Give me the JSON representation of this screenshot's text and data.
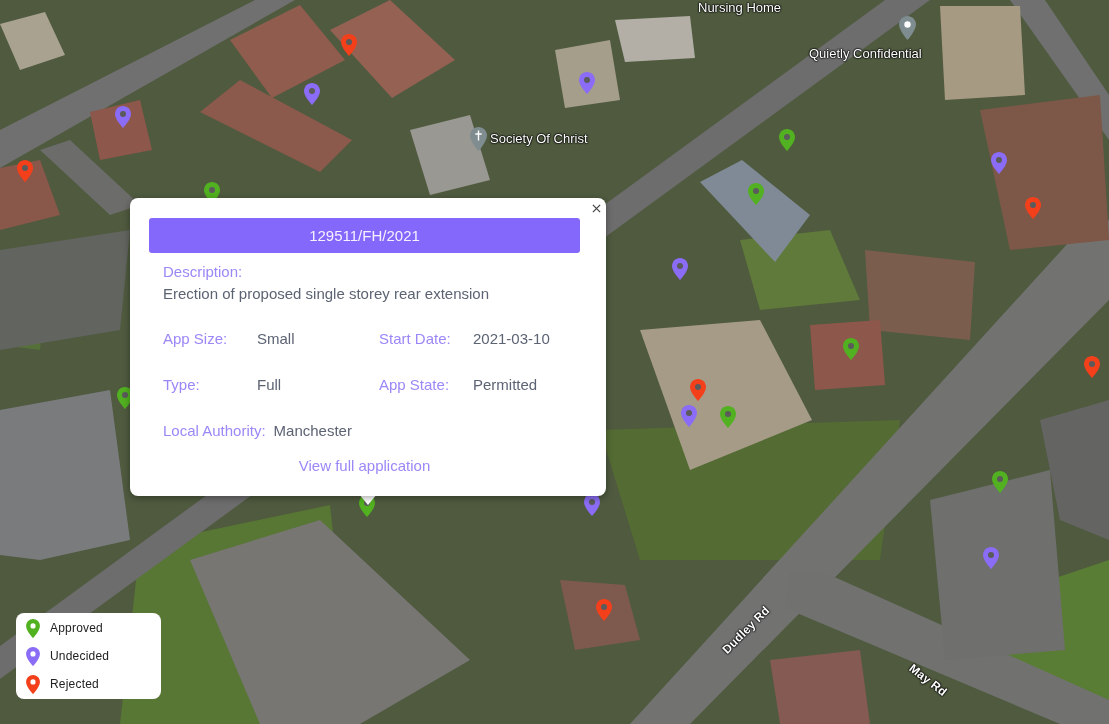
{
  "map_labels": [
    {
      "kind": "text",
      "text": "Nursing Home"
    },
    {
      "kind": "church",
      "text": "Society Of Christ"
    },
    {
      "kind": "place",
      "text": "Quietly Confidential"
    },
    {
      "kind": "road",
      "text": "Dudley Rd"
    },
    {
      "kind": "road",
      "text": "May Rd"
    }
  ],
  "pins": [
    {
      "color": "#f3401b"
    },
    {
      "color": "#8b6cf6"
    },
    {
      "color": "#8b6cf6"
    },
    {
      "color": "#f3401b"
    },
    {
      "color": "#52b120"
    },
    {
      "color": "#8b6cf6"
    },
    {
      "color": "#52b120"
    },
    {
      "color": "#52b120"
    },
    {
      "color": "#8b6cf6"
    },
    {
      "color": "#f3401b"
    },
    {
      "color": "#8b6cf6"
    },
    {
      "color": "#52b120"
    },
    {
      "color": "#f3401b"
    },
    {
      "color": "#f3401b"
    },
    {
      "color": "#8b6cf6"
    },
    {
      "color": "#52b120"
    },
    {
      "color": "#52b120"
    },
    {
      "color": "#52b120"
    },
    {
      "color": "#8b6cf6"
    },
    {
      "color": "#52b120"
    },
    {
      "color": "#8b6cf6"
    },
    {
      "color": "#f3401b"
    }
  ],
  "popup": {
    "title": "129511/FH/2021",
    "description": {
      "label": "Description:",
      "text": "Erection of proposed single storey rear extension"
    },
    "rows": [
      {
        "fields": [
          {
            "label": "App Size:",
            "value": "Small"
          },
          {
            "label": "Start Date:",
            "value": "2021-03-10"
          }
        ]
      },
      {
        "fields": [
          {
            "label": "Type:",
            "value": "Full"
          },
          {
            "label": "App State:",
            "value": "Permitted"
          }
        ]
      },
      {
        "fields": [
          {
            "label": "Local Authority:",
            "value": "Manchester"
          }
        ]
      }
    ],
    "link": "View full application"
  },
  "legend": [
    {
      "label": "Approved",
      "color": "#52b120"
    },
    {
      "label": "Undecided",
      "color": "#8b6cf6"
    },
    {
      "label": "Rejected",
      "color": "#f3401b"
    }
  ]
}
